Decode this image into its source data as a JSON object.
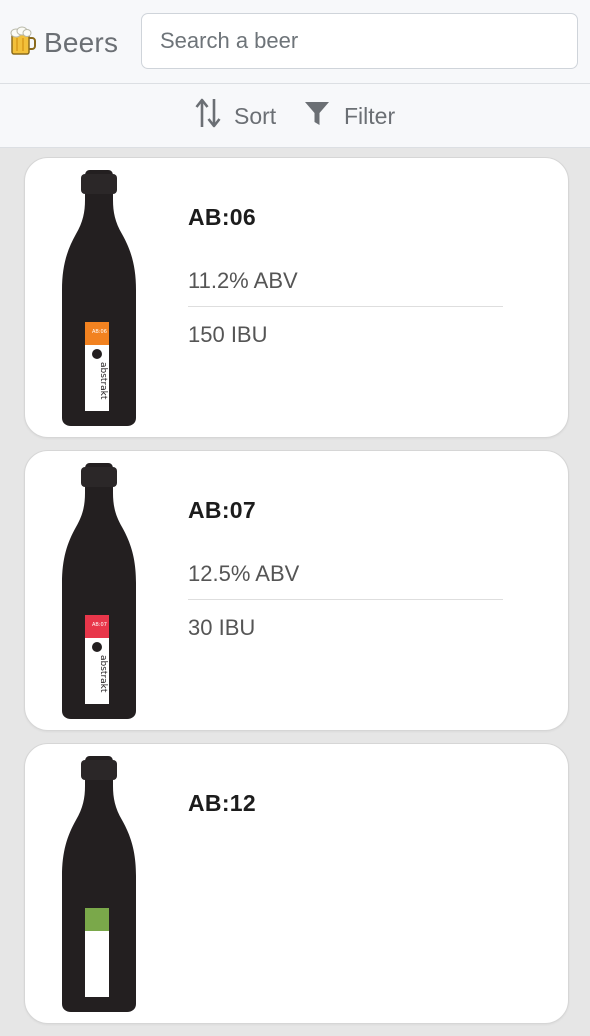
{
  "header": {
    "title": "Beers",
    "logo_icon": "beer-mug-icon"
  },
  "search": {
    "placeholder": "Search a beer",
    "value": ""
  },
  "toolbar": {
    "sort_label": "Sort",
    "sort_icon": "sort-arrows-icon",
    "filter_label": "Filter",
    "filter_icon": "funnel-icon"
  },
  "colors": {
    "bottle": "#231f20",
    "label_ab06": "#f28220",
    "label_ab07": "#e8364a",
    "label_ab12": "#7aa84a"
  },
  "beers": [
    {
      "name": "AB:06",
      "abv": "11.2% ABV",
      "ibu": "150 IBU",
      "label_color": "#f28220"
    },
    {
      "name": "AB:07",
      "abv": "12.5% ABV",
      "ibu": "30 IBU",
      "label_color": "#e8364a"
    },
    {
      "name": "AB:12",
      "abv": "",
      "ibu": "",
      "label_color": "#7aa84a"
    }
  ]
}
